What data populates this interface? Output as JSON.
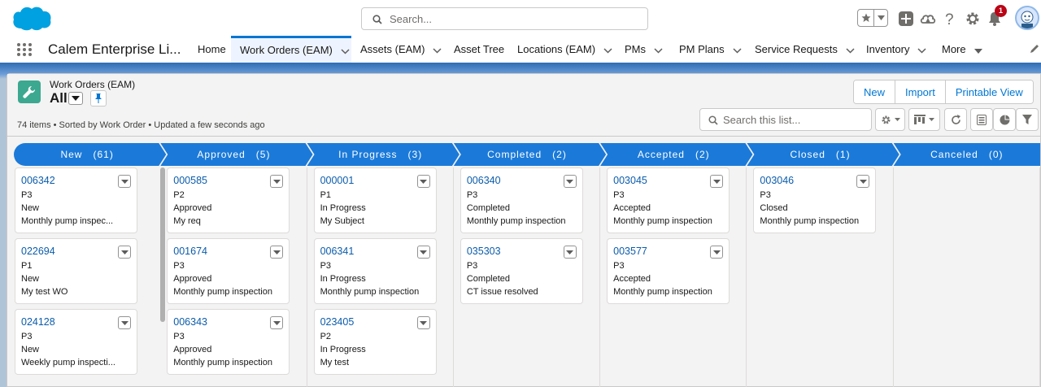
{
  "global": {
    "search_placeholder": "Search...",
    "notification_count": "1"
  },
  "nav": {
    "app_name": "Calem Enterprise Li...",
    "items": [
      {
        "label": "Home",
        "has_menu": false
      },
      {
        "label": "Work Orders (EAM)",
        "has_menu": true,
        "active": true
      },
      {
        "label": "Assets (EAM)",
        "has_menu": true
      },
      {
        "label": "Asset Tree",
        "has_menu": false
      },
      {
        "label": "Locations (EAM)",
        "has_menu": true
      },
      {
        "label": "PMs",
        "has_menu": true
      },
      {
        "label": "PM Plans",
        "has_menu": true
      },
      {
        "label": "Service Requests",
        "has_menu": true
      },
      {
        "label": "Inventory",
        "has_menu": true
      },
      {
        "label": "More",
        "has_menu": true
      }
    ]
  },
  "list_header": {
    "object_label": "Work Orders (EAM)",
    "view_name": "All",
    "meta": "74 items • Sorted by Work Order • Updated a few seconds ago",
    "buttons": [
      "New",
      "Import",
      "Printable View"
    ],
    "search_placeholder": "Search this list..."
  },
  "stages": [
    {
      "name": "New",
      "count": "(61)"
    },
    {
      "name": "Approved",
      "count": "(5)"
    },
    {
      "name": "In Progress",
      "count": "(3)"
    },
    {
      "name": "Completed",
      "count": "(2)"
    },
    {
      "name": "Accepted",
      "count": "(2)"
    },
    {
      "name": "Closed",
      "count": "(1)"
    },
    {
      "name": "Canceled",
      "count": "(0)"
    }
  ],
  "columns": [
    {
      "cards": [
        {
          "number": "006342",
          "priority": "P3",
          "status": "New",
          "subject": "Monthly pump inspec..."
        },
        {
          "number": "022694",
          "priority": "P1",
          "status": "New",
          "subject": "My test WO"
        },
        {
          "number": "024128",
          "priority": "P3",
          "status": "New",
          "subject": "Weekly pump inspecti..."
        }
      ]
    },
    {
      "cards": [
        {
          "number": "000585",
          "priority": "P2",
          "status": "Approved",
          "subject": "My req"
        },
        {
          "number": "001674",
          "priority": "P3",
          "status": "Approved",
          "subject": "Monthly pump inspection"
        },
        {
          "number": "006343",
          "priority": "P3",
          "status": "Approved",
          "subject": "Monthly pump inspection"
        }
      ]
    },
    {
      "cards": [
        {
          "number": "000001",
          "priority": "P1",
          "status": "In Progress",
          "subject": "My Subject"
        },
        {
          "number": "006341",
          "priority": "P3",
          "status": "In Progress",
          "subject": "Monthly pump inspection"
        },
        {
          "number": "023405",
          "priority": "P2",
          "status": "In Progress",
          "subject": "My test"
        }
      ]
    },
    {
      "cards": [
        {
          "number": "006340",
          "priority": "P3",
          "status": "Completed",
          "subject": "Monthly pump inspection"
        },
        {
          "number": "035303",
          "priority": "P3",
          "status": "Completed",
          "subject": "CT issue resolved"
        }
      ]
    },
    {
      "cards": [
        {
          "number": "003045",
          "priority": "P3",
          "status": "Accepted",
          "subject": "Monthly pump inspection"
        },
        {
          "number": "003577",
          "priority": "P3",
          "status": "Accepted",
          "subject": "Monthly pump inspection"
        }
      ]
    },
    {
      "cards": [
        {
          "number": "003046",
          "priority": "P3",
          "status": "Closed",
          "subject": "Monthly pump inspection"
        }
      ]
    },
    {
      "cards": []
    }
  ],
  "colors": {
    "brand_blue": "#0176d3",
    "stage_blue": "#1b7ad9",
    "object_icon": "#3ba88f",
    "link": "#0b5cab",
    "badge_red": "#ba0517"
  },
  "icons": {
    "logo": "salesforce-cloud-logo",
    "app_launcher": "waffle-grid-icon",
    "object": "wrench-icon"
  }
}
